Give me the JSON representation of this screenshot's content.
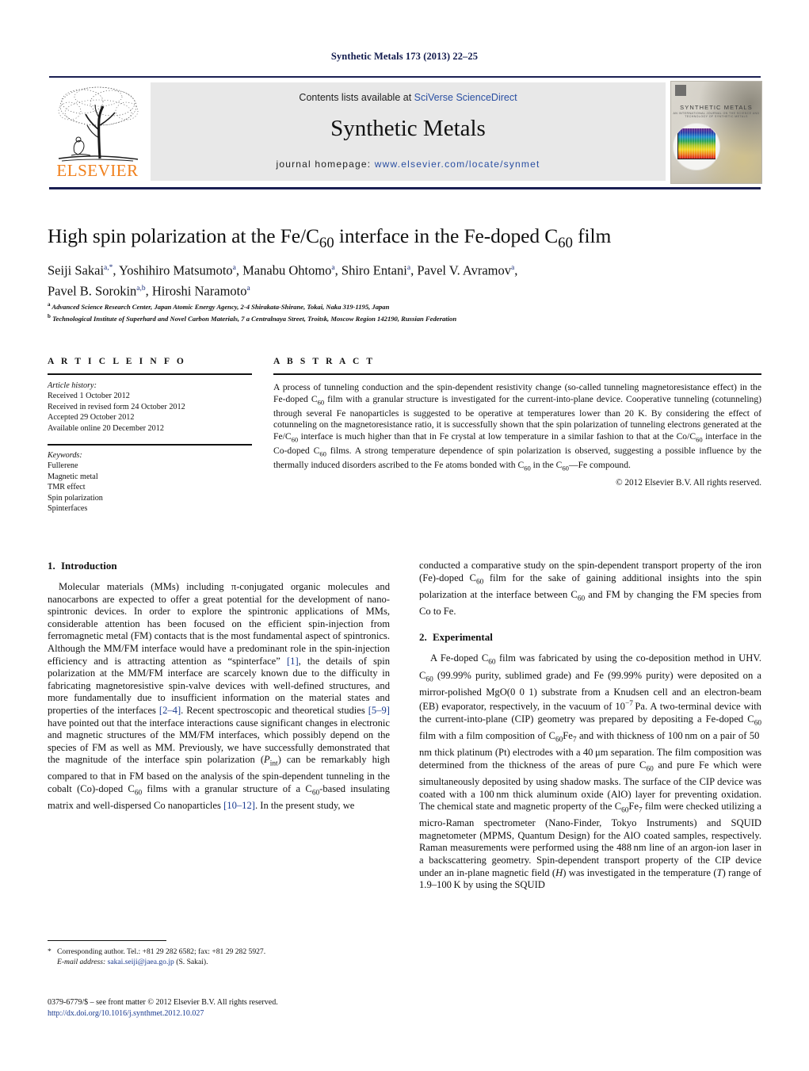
{
  "running_head": "Synthetic Metals 173 (2013) 22–25",
  "masthead": {
    "contents_prefix": "Contents lists available at ",
    "sciencedirect": "SciVerse ScienceDirect",
    "journal_name": "Synthetic Metals",
    "homepage_prefix": "journal homepage: ",
    "homepage_url": "www.elsevier.com/locate/synmet",
    "publisher": "ELSEVIER",
    "cover_title": "SYNTHETIC METALS",
    "cover_subtitle": "AN INTERNATIONAL JOURNAL ON THE SCIENCE AND TECHNOLOGY OF SYNTHETIC METALS"
  },
  "colors": {
    "link": "#1a3a8f",
    "sciencedirect": "#2a4fa2",
    "elsevier_orange": "#f07f1a",
    "rule_navy": "#1a1f52",
    "banner_gray": "#e8e8e8"
  },
  "article": {
    "title_part1": "High spin polarization at the Fe/C",
    "title_sub1": "60",
    "title_part2": " interface in the Fe-doped C",
    "title_sub2": "60",
    "title_part3": " film",
    "title_plain": "High spin polarization at the Fe/C60 interface in the Fe-doped C60 film",
    "authors_line1": "Seiji Sakai a,*, Yoshihiro Matsumoto a, Manabu Ohtomo a, Shiro Entani a, Pavel V. Avramov a,",
    "authors_line2": "Pavel B. Sorokin a,b, Hiroshi Naramoto a",
    "affiliation_a": "Advanced Science Research Center, Japan Atomic Energy Agency, 2-4 Shirakata-Shirane, Tokai, Naka 319-1195, Japan",
    "affiliation_b": "Technological Institute of Superhard and Novel Carbon Materials, 7 a Centralnaya Street, Troitsk, Moscow Region 142190, Russian Federation"
  },
  "article_info": {
    "heading": "A R T I C L E   I N F O",
    "history_label": "Article history:",
    "history": [
      "Received 1 October 2012",
      "Received in revised form 24 October 2012",
      "Accepted 29 October 2012",
      "Available online 20 December 2012"
    ],
    "keywords_label": "Keywords:",
    "keywords": [
      "Fullerene",
      "Magnetic metal",
      "TMR effect",
      "Spin polarization",
      "Spinterfaces"
    ]
  },
  "abstract": {
    "heading": "A B S T R A C T",
    "text": "A process of tunneling conduction and the spin-dependent resistivity change (so-called tunneling magnetoresistance effect) in the Fe-doped C60 film with a granular structure is investigated for the current-into-plane device. Cooperative tunneling (cotunneling) through several Fe nanoparticles is suggested to be operative at temperatures lower than 20 K. By considering the effect of cotunneling on the magnetoresistance ratio, it is successfully shown that the spin polarization of tunneling electrons generated at the Fe/C60 interface is much higher than that in Fe crystal at low temperature in a similar fashion to that at the Co/C60 interface in the Co-doped C60 films. A strong temperature dependence of spin polarization is observed, suggesting a possible influence by the thermally induced disorders ascribed to the Fe atoms bonded with C60 in the C60—Fe compound.",
    "copyright": "© 2012 Elsevier B.V. All rights reserved."
  },
  "sections": {
    "intro_number": "1.",
    "intro_title": "Introduction",
    "intro_p1": "Molecular materials (MMs) including π-conjugated organic molecules and nanocarbons are expected to offer a great potential for the development of nano-spintronic devices. In order to explore the spintronic applications of MMs, considerable attention has been focused on the efficient spin-injection from ferromagnetic metal (FM) contacts that is the most fundamental aspect of spintronics. Although the MM/FM interface would have a predominant role in the spin-injection efficiency and is attracting attention as \"spinterface\" [1], the details of spin polarization at the MM/FM interface are scarcely known due to the difficulty in fabricating magnetoresistive spin-valve devices with well-defined structures, and more fundamentally due to insufficient information on the material states and properties of the interfaces [2–4]. Recent spectroscopic and theoretical studies [5–9] have pointed out that the interface interactions cause significant changes in electronic and magnetic structures of the MM/FM interfaces, which possibly depend on the species of FM as well as MM. Previously, we have successfully demonstrated that the magnitude of the interface spin polarization (Pint) can be remarkably high compared to that in FM based on the analysis of the spin-dependent tunneling in the cobalt (Co)-doped C60 films with a granular structure of a C60-based insulating matrix and well-dispersed Co nanoparticles [10–12]. In the present study, we conducted a comparative study on the spin-dependent transport property of the iron (Fe)-doped C60 film for the sake of gaining additional insights into the spin polarization at the interface between C60 and FM by changing the FM species from Co to Fe.",
    "exp_number": "2.",
    "exp_title": "Experimental",
    "exp_p1": "A Fe-doped C60 film was fabricated by using the co-deposition method in UHV. C60 (99.99% purity, sublimed grade) and Fe (99.99% purity) were deposited on a mirror-polished MgO(0 0 1) substrate from a Knudsen cell and an electron-beam (EB) evaporator, respectively, in the vacuum of 10−7 Pa. A two-terminal device with the current-into-plane (CIP) geometry was prepared by depositing a Fe-doped C60 film with a film composition of C60Fe7 and with thickness of 100 nm on a pair of 50 nm thick platinum (Pt) electrodes with a 40 μm separation. The film composition was determined from the thickness of the areas of pure C60 and pure Fe which were simultaneously deposited by using shadow masks. The surface of the CIP device was coated with a 100 nm thick aluminum oxide (AlO) layer for preventing oxidation. The chemical state and magnetic property of the C60Fe7 film were checked utilizing a micro-Raman spectrometer (Nano-Finder, Tokyo Instruments) and SQUID magnetometer (MPMS, Quantum Design) for the AlO coated samples, respectively. Raman measurements were performed using the 488 nm line of an argon-ion laser in a backscattering geometry. Spin-dependent transport property of the CIP device under an in-plane magnetic field (H) was investigated in the temperature (T) range of 1.9–100 K by using the SQUID"
  },
  "footnote": {
    "star": "*",
    "corresponding": "Corresponding author. Tel.: +81 29 282 6582; fax: +81 29 282 5927.",
    "email_label": "E-mail address:",
    "email": "sakai.seiji@jaea.go.jp",
    "email_owner": "(S. Sakai).",
    "issn_line": "0379-6779/$ – see front matter © 2012 Elsevier B.V. All rights reserved.",
    "doi": "http://dx.doi.org/10.1016/j.synthmet.2012.10.027"
  }
}
